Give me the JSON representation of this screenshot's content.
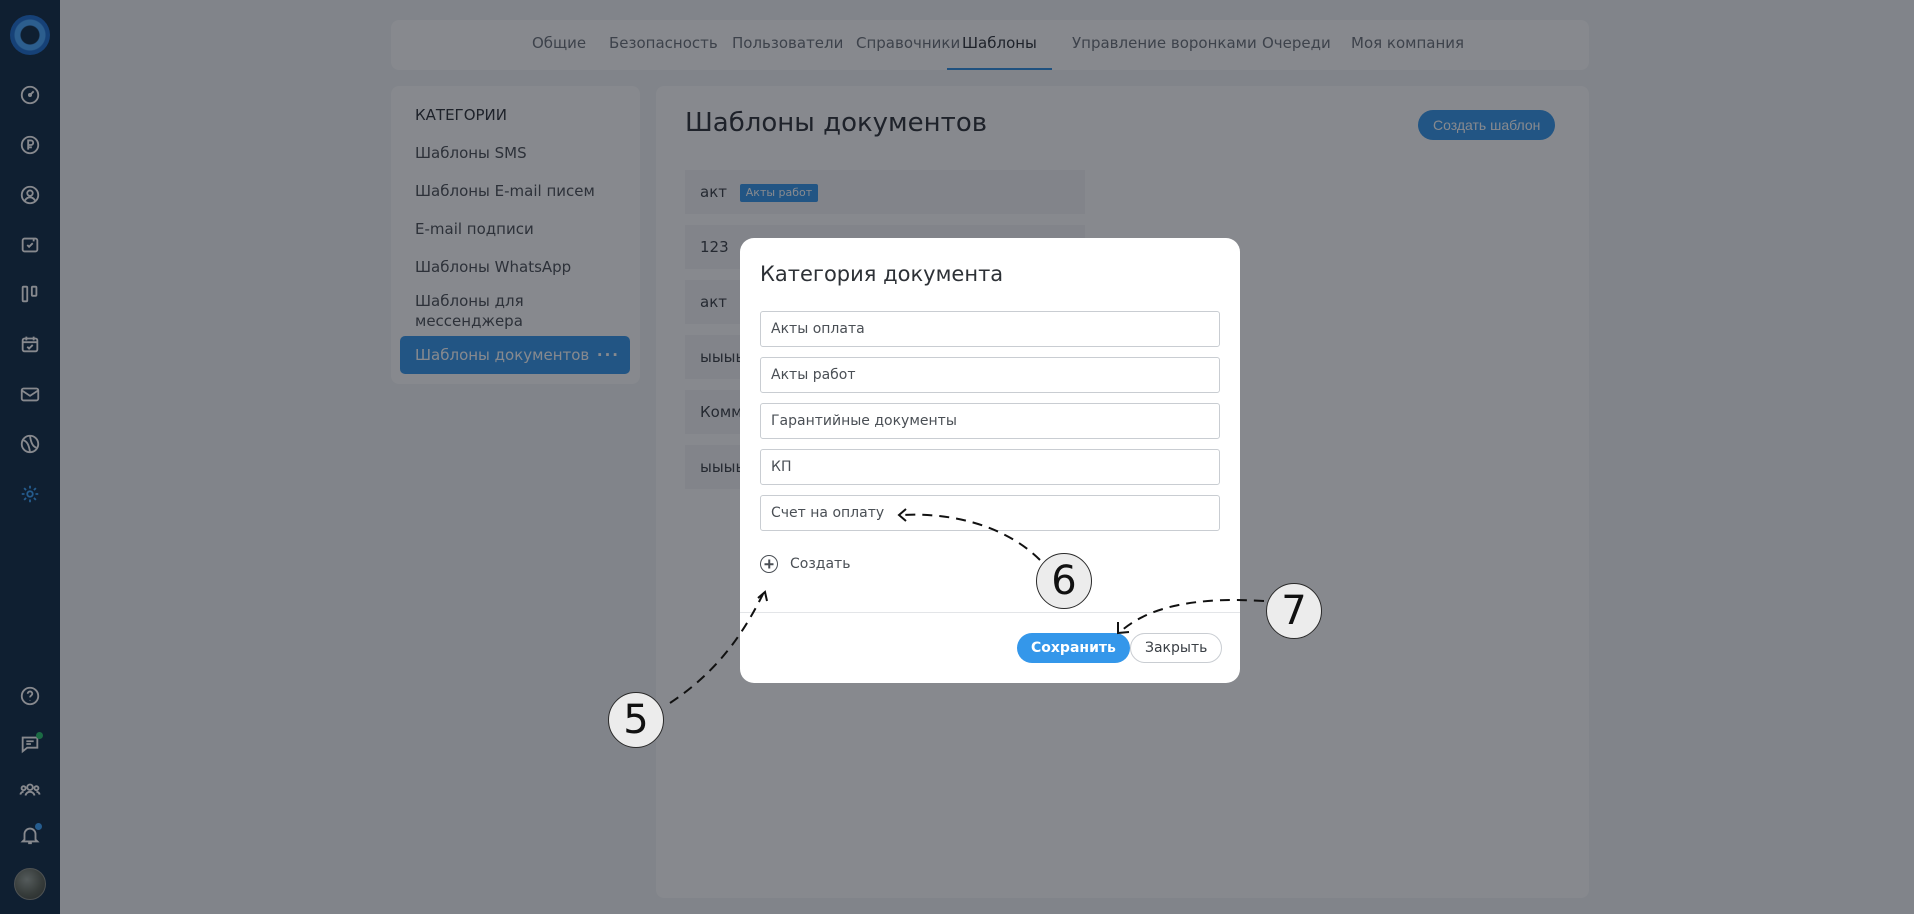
{
  "tabs": [
    "Общие",
    "Безопасность",
    "Пользователи",
    "Справочники",
    "Шаблоны",
    "Управление воронками",
    "Очереди",
    "Моя компания"
  ],
  "active_tab": "Шаблоны",
  "categories": {
    "header": "КАТЕГОРИИ",
    "items": [
      "Шаблоны SMS",
      "Шаблоны E-mail писем",
      "E-mail подписи",
      "Шаблоны WhatsApp",
      "Шаблоны для мессенджера"
    ],
    "selected": "Шаблоны документов",
    "selected_more": "···"
  },
  "main": {
    "title": "Шаблоны документов",
    "create_button": "Создать шаблон",
    "rows": [
      {
        "name": "акт",
        "badge": "Акты работ"
      },
      {
        "name": "123",
        "badge": ""
      },
      {
        "name": "акт",
        "badge": ""
      },
      {
        "name": "ыыыы",
        "badge": ""
      },
      {
        "name": "Комм",
        "badge": ""
      },
      {
        "name": "ыыыы",
        "badge": ""
      }
    ]
  },
  "modal": {
    "title": "Категория документа",
    "fields": [
      "Акты оплата",
      "Акты работ",
      "Гарантийные документы",
      "КП",
      "Счет на оплату"
    ],
    "add_label": "Создать",
    "save_label": "Сохранить",
    "close_label": "Закрыть"
  },
  "callouts": [
    "5",
    "6",
    "7"
  ],
  "colors": {
    "accent": "#3497ea",
    "rail": "#0f2a44",
    "active_icon": "#3aa5ff"
  }
}
